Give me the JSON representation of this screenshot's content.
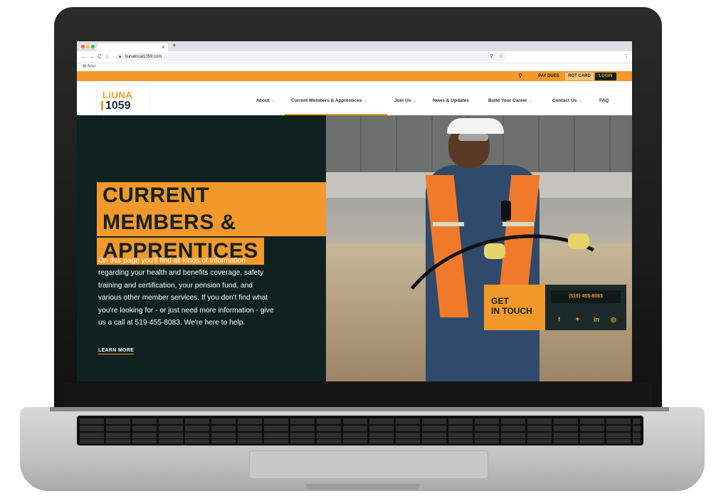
{
  "browser": {
    "tab_close": "×",
    "new_tab": "+",
    "nav": {
      "back": "←",
      "forward": "→",
      "reload": "C",
      "home": "⌂"
    },
    "url": "liunalocal1059.com",
    "location_icon": "location-pin-icon",
    "star_icon": "star-icon",
    "menu": "⋮",
    "bookmark": "Apps"
  },
  "site": {
    "utility": {
      "search_icon": "⚲",
      "pay_dues": "PAY DUES",
      "rot_card": "ROT CARD",
      "login": "LOGIN"
    },
    "logo": {
      "top": "LiUNA",
      "bottom": "1059"
    },
    "nav": [
      {
        "label": "About",
        "dropdown": true
      },
      {
        "label": "Current Members & Apprentices",
        "dropdown": true
      },
      {
        "label": "Join Us",
        "dropdown": true
      },
      {
        "label": "News & Updates",
        "dropdown": false
      },
      {
        "label": "Build Your Career",
        "dropdown": true
      },
      {
        "label": "Contact Us",
        "dropdown": true
      },
      {
        "label": "FAQ",
        "dropdown": false
      }
    ],
    "hero": {
      "title_line1": "CURRENT MEMBERS &",
      "title_line2": "APPRENTICES",
      "body": "On this page you'll find all kinds of information regarding your health and benefits coverage, safety training and certification, your pension fund, and various other member services. If you don't find what you're looking for - or just need more information - give us a call at 519-455-8083. We're here to help.",
      "learn_more": "LEARN MORE"
    },
    "contact": {
      "get_in_touch_line1": "GET",
      "get_in_touch_line2": "IN TOUCH",
      "phone": "(519) 455-8083",
      "social": {
        "facebook": "f",
        "twitter": "🐦",
        "linkedin": "in",
        "instagram": "◎"
      }
    }
  },
  "colors": {
    "accent": "#f3982a",
    "dark": "#10221f",
    "text_light": "#ffffff"
  }
}
